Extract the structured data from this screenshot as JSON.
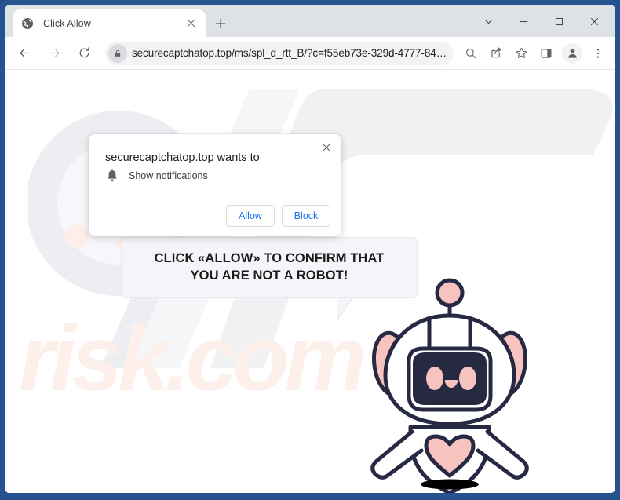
{
  "window": {
    "frame_color": "#255390",
    "controls": [
      {
        "name": "tab-search-button",
        "icon": "chevron-down-icon",
        "label": "⌄"
      },
      {
        "name": "minimize-button",
        "icon": "minimize-icon",
        "label": "—"
      },
      {
        "name": "maximize-button",
        "icon": "maximize-icon",
        "label": "□"
      },
      {
        "name": "close-button",
        "icon": "close-icon",
        "label": "✕"
      }
    ]
  },
  "tab_strip": {
    "background": "#dee1e6",
    "active_tab": {
      "title": "Click Allow",
      "favicon": "globe-icon",
      "close_label": "✕"
    },
    "new_tab_label": "+"
  },
  "toolbar": {
    "back_label": "←",
    "forward_label": "→",
    "reload_label": "↻",
    "url": "securecaptchatop.top/ms/spl_d_rtt_B/?c=f55eb73e-329d-4777-841b-…",
    "url_placeholder": "Search Google or type a URL",
    "lock_icon": "lock-icon",
    "actions": [
      {
        "name": "search-icon",
        "label": "search"
      },
      {
        "name": "share-icon",
        "label": "share"
      },
      {
        "name": "bookmark-star-icon",
        "label": "bookmark"
      },
      {
        "name": "side-panel-icon",
        "label": "side panel"
      }
    ],
    "profile_icon": "profile-avatar-icon",
    "menu_label": "⋮"
  },
  "permission_dialog": {
    "title": "securecaptchatop.top wants to",
    "item_icon": "bell-icon",
    "item_label": "Show notifications",
    "close_label": "✕",
    "allow_label": "Allow",
    "block_label": "Block",
    "button_text_color": "#1a73e8"
  },
  "page": {
    "speech_bubble_text": "CLICK «ALLOW» TO CONFIRM THAT YOU ARE NOT A ROBOT!",
    "watermark_text": "risk.com",
    "watermark_color": "#fdefe9",
    "robot_outline_color": "#272943",
    "robot_accent_color": "#f7c3be",
    "robot_face_color": "#272943",
    "background_color": "#ffffff"
  }
}
